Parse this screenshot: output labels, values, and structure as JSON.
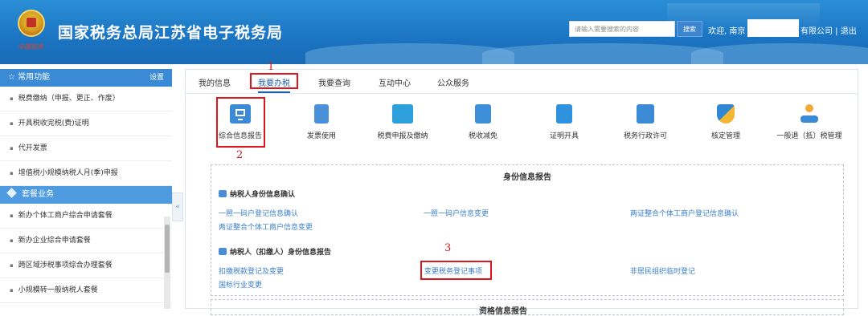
{
  "header": {
    "site_title": "国家税务总局江苏省电子税务局",
    "signature": "中国税务",
    "search_placeholder": "请输入需要搜索的内容",
    "search_button": "搜索",
    "welcome": "欢迎, 南京",
    "company_links": "有限公司 | 退出"
  },
  "sidebar": {
    "common_title": "☆ 常用功能",
    "settings": "设置",
    "common_items": [
      "税费缴纳（申报、更正、作废）",
      "开具税收完税(费)证明",
      "代开发票",
      "增值税小规模纳税人月(季)申报"
    ],
    "package_title": "套餐业务",
    "package_items": [
      "新办个体工商户综合申请套餐",
      "新办企业综合申请套餐",
      "跨区域涉税事项综合办理套餐",
      "小规模转一般纳税人套餐"
    ],
    "collapse": "«"
  },
  "tabs": [
    "我的信息",
    "我要办税",
    "我要查询",
    "互动中心",
    "公众服务"
  ],
  "annotations": [
    "1",
    "2",
    "3"
  ],
  "functions": [
    {
      "label": "综合信息报告",
      "icon": "monitor-chart-icon"
    },
    {
      "label": "发票使用",
      "icon": "document-icon"
    },
    {
      "label": "税费申报及缴纳",
      "icon": "computer-icon"
    },
    {
      "label": "税收减免",
      "icon": "calculator-icon"
    },
    {
      "label": "证明开具",
      "icon": "certificate-icon"
    },
    {
      "label": "税务行政许可",
      "icon": "form-icon"
    },
    {
      "label": "核定管理",
      "icon": "shield-icon"
    },
    {
      "label": "一般退（抵）税管理",
      "icon": "network-icon"
    }
  ],
  "panel": {
    "title": "身份信息报告",
    "section1": "纳税人身份信息确认",
    "section1_links": [
      "一照一码户登记信息确认",
      "一照一码户信息变更",
      "两证整合个体工商户登记信息确认",
      "两证整合个体工商户信息变更"
    ],
    "section2": "纳税人（扣缴人）身份信息报告",
    "section2_links": [
      "扣缴税款登记及变更",
      "变更税务登记事项",
      "非居民组织临时登记",
      "国标行业变更"
    ],
    "next_title": "资格信息报告"
  },
  "colors": {
    "header_blue": "#1b74c2",
    "highlight_red": "#e0141b",
    "link_blue": "#3a7fcc",
    "active_tab": "#1f5fa8"
  }
}
